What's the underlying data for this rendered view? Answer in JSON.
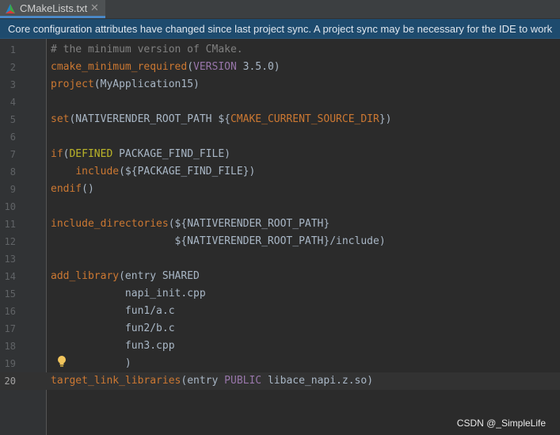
{
  "tab": {
    "label": "CMakeLists.txt",
    "close_glyph": "✕",
    "icon": "cmake-icon",
    "accent": "#4a88c7"
  },
  "banner": {
    "text": "Core configuration attributes have changed since last project sync. A project sync may be necessary for the IDE to work"
  },
  "editor": {
    "current_line": "20",
    "lines": [
      {
        "n": "1",
        "tokens": [
          {
            "t": "# the minimum version of CMake.",
            "c": "comment"
          }
        ]
      },
      {
        "n": "2",
        "tokens": [
          {
            "t": "cmake_minimum_required",
            "c": "fn"
          },
          {
            "t": "(",
            "c": "text"
          },
          {
            "t": "VERSION",
            "c": "kw"
          },
          {
            "t": " 3.5.0)",
            "c": "text"
          }
        ]
      },
      {
        "n": "3",
        "tokens": [
          {
            "t": "project",
            "c": "fn"
          },
          {
            "t": "(MyApplication15)",
            "c": "text"
          }
        ]
      },
      {
        "n": "4",
        "tokens": []
      },
      {
        "n": "5",
        "tokens": [
          {
            "t": "set",
            "c": "fn"
          },
          {
            "t": "(NATIVERENDER_ROOT_PATH ${",
            "c": "text"
          },
          {
            "t": "CMAKE_CURRENT_SOURCE_DIR",
            "c": "var"
          },
          {
            "t": "})",
            "c": "text"
          }
        ]
      },
      {
        "n": "6",
        "tokens": []
      },
      {
        "n": "7",
        "tokens": [
          {
            "t": "if",
            "c": "fn"
          },
          {
            "t": "(",
            "c": "text"
          },
          {
            "t": "DEFINED",
            "c": "kw2"
          },
          {
            "t": " PACKAGE_FIND_FILE)",
            "c": "text"
          }
        ]
      },
      {
        "n": "8",
        "tokens": [
          {
            "t": "    ",
            "c": "text"
          },
          {
            "t": "include",
            "c": "fn"
          },
          {
            "t": "(${PACKAGE_FIND_FILE})",
            "c": "text"
          }
        ]
      },
      {
        "n": "9",
        "tokens": [
          {
            "t": "endif",
            "c": "fn"
          },
          {
            "t": "()",
            "c": "text"
          }
        ]
      },
      {
        "n": "10",
        "tokens": []
      },
      {
        "n": "11",
        "tokens": [
          {
            "t": "include_directories",
            "c": "fn"
          },
          {
            "t": "(${NATIVERENDER_ROOT_PATH}",
            "c": "text"
          }
        ]
      },
      {
        "n": "12",
        "tokens": [
          {
            "t": "                    ${NATIVERENDER_ROOT_PATH}/include)",
            "c": "text"
          }
        ]
      },
      {
        "n": "13",
        "tokens": []
      },
      {
        "n": "14",
        "tokens": [
          {
            "t": "add_library",
            "c": "fn"
          },
          {
            "t": "(entry SHARED",
            "c": "text"
          }
        ]
      },
      {
        "n": "15",
        "tokens": [
          {
            "t": "            napi_init.cpp",
            "c": "text"
          }
        ]
      },
      {
        "n": "16",
        "tokens": [
          {
            "t": "            fun1/a.c",
            "c": "text"
          }
        ]
      },
      {
        "n": "17",
        "tokens": [
          {
            "t": "            fun2/b.c",
            "c": "text"
          }
        ]
      },
      {
        "n": "18",
        "tokens": [
          {
            "t": "            fun3.cpp",
            "c": "text"
          }
        ]
      },
      {
        "n": "19",
        "tokens": [
          {
            "t": "            )",
            "c": "text"
          }
        ]
      },
      {
        "n": "20",
        "tokens": [
          {
            "t": "target_link_libraries",
            "c": "fn"
          },
          {
            "t": "(entry ",
            "c": "text"
          },
          {
            "t": "PUBLIC",
            "c": "kw"
          },
          {
            "t": " libace_napi.z.so)",
            "c": "text"
          }
        ]
      }
    ],
    "intention_icon": "lightbulb-icon"
  },
  "watermark": {
    "text": "CSDN @_SimpleLife"
  }
}
